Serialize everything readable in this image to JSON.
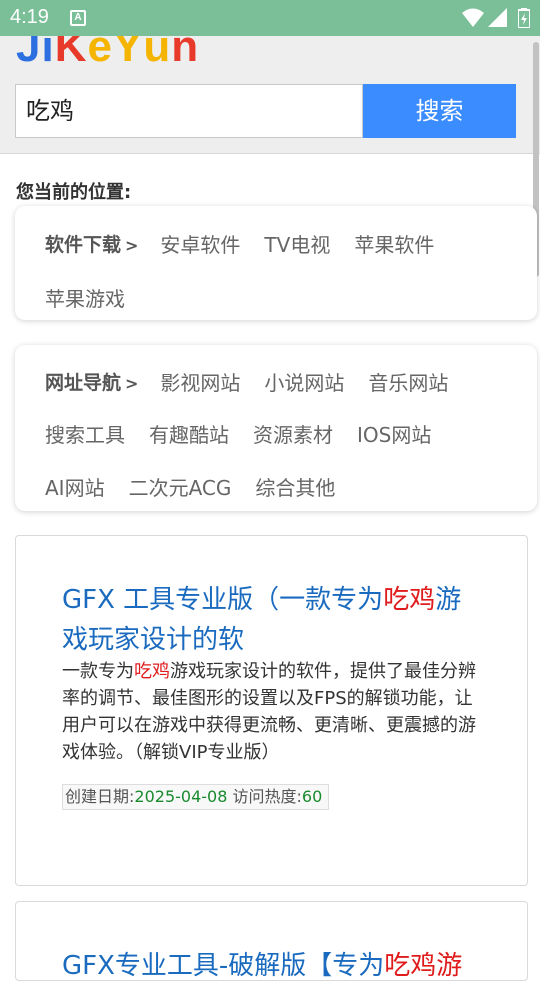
{
  "status_bar": {
    "time": "4:19",
    "notification_icon": "A"
  },
  "header": {
    "logo_letters": [
      {
        "ch": "J",
        "color": "#2d6fe0"
      },
      {
        "ch": "i",
        "color": "#2d6fe0"
      },
      {
        "ch": "K",
        "color": "#e83a2a"
      },
      {
        "ch": "e",
        "color": "#f4b400"
      },
      {
        "ch": "Y",
        "color": "#f4b400"
      },
      {
        "ch": "u",
        "color": "#f4b400"
      },
      {
        "ch": "n",
        "color": "#e83a2a"
      }
    ],
    "search_value": "吃鸡",
    "search_button": "搜索"
  },
  "location_label": "您当前的位置:",
  "software_nav": {
    "head": "软件下载",
    "arrow": ">",
    "links": [
      "安卓软件",
      "TV电视",
      "苹果软件",
      "苹果游戏"
    ]
  },
  "site_nav": {
    "head": "网址导航",
    "arrow": ">",
    "links": [
      "影视网站",
      "小说网站",
      "音乐网站",
      "搜索工具",
      "有趣酷站",
      "资源素材",
      "IOS网站",
      "AI网站",
      "二次元ACG",
      "综合其他"
    ]
  },
  "articles": [
    {
      "title_pre": "GFX 工具专业版（一款专为",
      "title_hl": "吃鸡",
      "title_post": "游戏玩家设计的软",
      "desc_pre": "一款专为",
      "desc_hl": "吃鸡",
      "desc_post": "游戏玩家设计的软件，提供了最佳分辨率的调节、最佳图形的设置以及FPS的解锁功能，让用户可以在游戏中获得更流畅、更清晰、更震撼的游戏体验。（解锁VIP专业版）",
      "date_label": "创建日期:",
      "date_value": "2025-04-08",
      "heat_label": "访问热度:",
      "heat_value": "60"
    },
    {
      "title_pre": "GFX专业工具-破解版【专为",
      "title_hl": "吃鸡游"
    }
  ],
  "colors": {
    "status_bar": "#7bbf99",
    "search_button": "#3b8cff",
    "title": "#1a6bbf",
    "highlight": "#e01b1b",
    "meta_value": "#1a8a2e"
  }
}
